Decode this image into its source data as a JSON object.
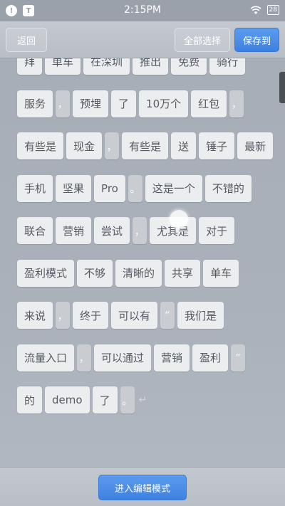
{
  "status": {
    "time": "2:15PM",
    "battery": "28",
    "left_icon_1": "!",
    "left_icon_2": "T"
  },
  "toolbar": {
    "back_label": "返回",
    "select_all_label": "全部选择",
    "save_label": "保存到"
  },
  "tokens": {
    "r0": [
      "拜",
      "单车",
      "在深圳",
      "推出",
      "免费",
      "骑行"
    ],
    "r1": [
      "服务",
      "，",
      "预埋",
      "了",
      "10万个",
      "红包",
      "，"
    ],
    "r2": [
      "有些是",
      "现金",
      "，",
      "有些是",
      "送",
      "锤子",
      "最新"
    ],
    "r3": [
      "手机",
      "坚果",
      "Pro",
      "。",
      "这是一个",
      "不错的"
    ],
    "r4": [
      "联合",
      "营销",
      "尝试",
      "，",
      "尤其是",
      "对于"
    ],
    "r5": [
      "盈利模式",
      "不够",
      "清晰的",
      "共享",
      "单车"
    ],
    "r6": [
      "来说",
      "，",
      "终于",
      "可以有",
      "“",
      "我们是"
    ],
    "r7": [
      "流量入口",
      "，",
      "可以通过",
      "营销",
      "盈利",
      "”"
    ],
    "r8": [
      "的",
      "demo",
      "了",
      "。"
    ]
  },
  "newline_mark": "↵",
  "bottom": {
    "edit_mode_label": "进入编辑模式"
  }
}
